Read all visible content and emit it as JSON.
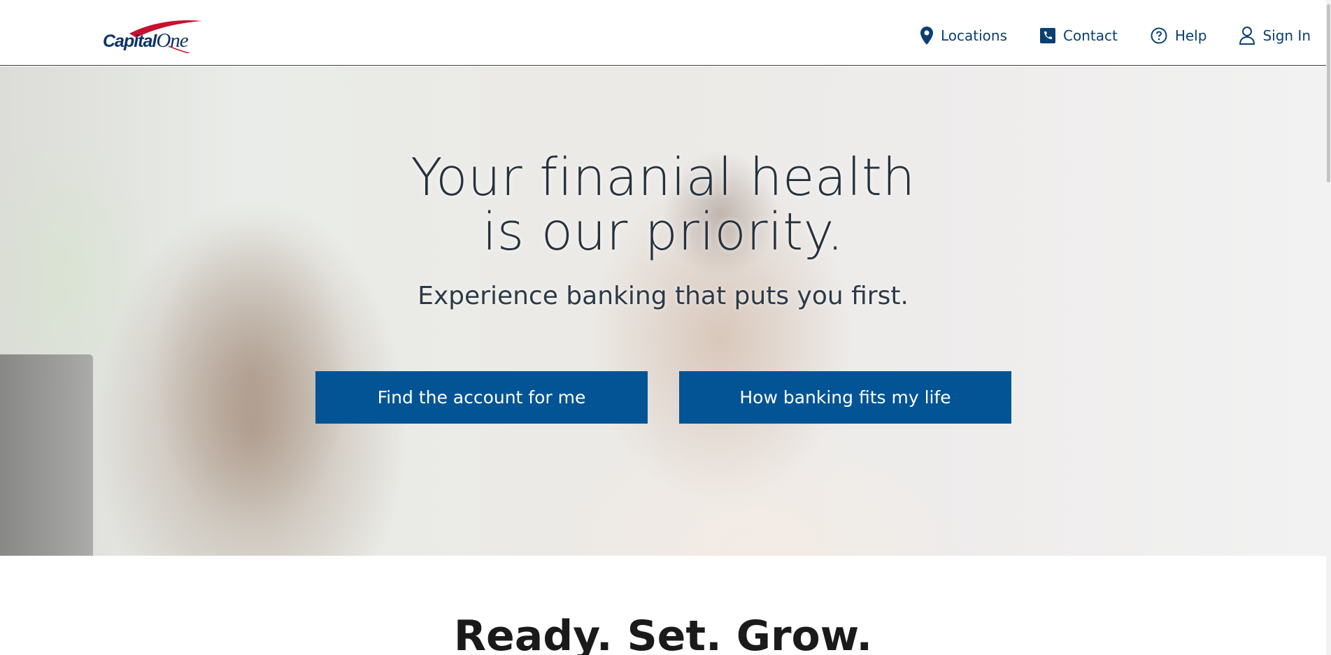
{
  "header": {
    "logo": {
      "brand": "Capital One"
    },
    "nav": [
      {
        "label": "Locations",
        "icon": "location-pin-icon"
      },
      {
        "label": "Contact",
        "icon": "phone-icon"
      },
      {
        "label": "Help",
        "icon": "help-circle-icon"
      },
      {
        "label": "Sign In",
        "icon": "user-icon"
      }
    ]
  },
  "hero": {
    "title_line1": "Your finanial health",
    "title_line2": "is our priority.",
    "subtitle": "Experience banking that puts you first.",
    "buttons": [
      {
        "label": "Find the account for me"
      },
      {
        "label": "How banking fits my life"
      }
    ]
  },
  "section": {
    "title": "Ready. Set. Grow."
  },
  "colors": {
    "brand_blue": "#025495",
    "nav_text": "#0a3f72",
    "logo_red": "#c8102e"
  }
}
